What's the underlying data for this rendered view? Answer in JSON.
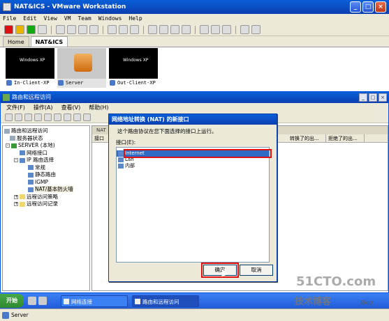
{
  "vmware": {
    "title": "NAT&ICS - VMware Workstation",
    "menu": [
      "File",
      "Edit",
      "View",
      "VM",
      "Team",
      "Windows",
      "Help"
    ],
    "tabs": [
      {
        "label": "Home"
      },
      {
        "label": "NAT&ICS"
      }
    ],
    "thumbnails": [
      {
        "label": "In-Client-XP",
        "logo": "Windows XP"
      },
      {
        "label": "Server"
      },
      {
        "label": "Out-Client-XP",
        "logo": "Windows XP"
      }
    ],
    "status_text": "Server"
  },
  "rras": {
    "title": "路由和远程访问",
    "menu": [
      "文件(F)",
      "操作(A)",
      "查看(V)",
      "帮助(H)"
    ],
    "tree": [
      {
        "label": "路由和远程访问"
      },
      {
        "label": "服务器状态"
      },
      {
        "label": "SERVER (本地)"
      },
      {
        "label": "网络接口"
      },
      {
        "label": "IP 路由选择"
      },
      {
        "label": "常规"
      },
      {
        "label": "静态路由"
      },
      {
        "label": "IGMP"
      },
      {
        "label": "NAT/基本防火墙"
      },
      {
        "label": "远程访问策略"
      },
      {
        "label": "远程访问记录"
      }
    ],
    "right_header": "NAT",
    "columns": [
      "接口",
      "转换了的出...",
      "拒绝了的出..."
    ]
  },
  "dialog": {
    "title": "网络地址转换 (NAT) 的新接口",
    "description": "这个路由协议在您下面选择的接口上运行。",
    "list_label": "接口(E):",
    "interfaces": [
      "Internet",
      "Lan",
      "内部"
    ],
    "ok": "确定",
    "cancel": "取消"
  },
  "taskbar": {
    "start": "开始",
    "tasks": [
      "网络连接",
      "路由和远程访问"
    ]
  },
  "watermark": {
    "line1": "51CTO.com",
    "line2": "技术博客",
    "line3": "Blog"
  },
  "colors": {
    "xp_blue": "#0b3fb0",
    "highlight_red": "#e01010",
    "selection": "#316ac5"
  }
}
